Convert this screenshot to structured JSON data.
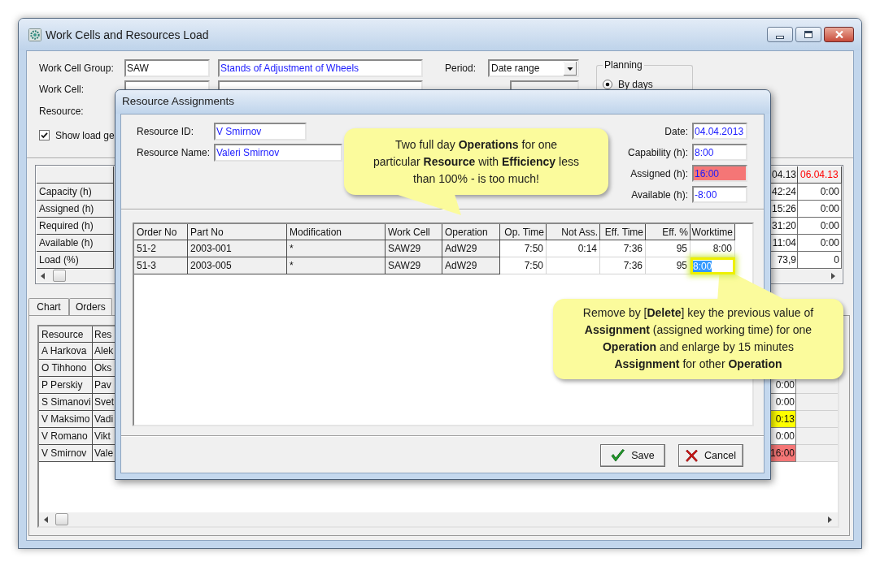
{
  "main_window": {
    "title": "Work Cells and Resources Load",
    "filters": {
      "work_cell_group": {
        "label": "Work Cell Group:",
        "code": "SAW",
        "description": "Stands of Adjustment of Wheels"
      },
      "work_cell": {
        "label": "Work Cell:"
      },
      "resource": {
        "label": "Resource:"
      },
      "show_load": {
        "label": "Show load ge",
        "checked": true
      },
      "period": {
        "label": "Period:",
        "value": "Date range"
      },
      "planning": {
        "title": "Planning",
        "options": [
          {
            "label": "By days",
            "selected": true
          }
        ]
      }
    },
    "load_grid": {
      "row_labels": [
        "Capacity (h)",
        "Assigned (h)",
        "Required (h)",
        "Available (h)",
        "Load (%)"
      ],
      "columns": [
        {
          "header": "04.13",
          "highlighted": false,
          "values": [
            "42:24",
            "15:26",
            "31:20",
            "11:04",
            "73,9"
          ]
        },
        {
          "header": "06.04.13",
          "highlighted": true,
          "values": [
            "0:00",
            "0:00",
            "0:00",
            "0:00",
            "0"
          ]
        }
      ]
    },
    "tabs": [
      {
        "label": "Chart",
        "selected": false
      },
      {
        "label": "Orders",
        "selected": false
      }
    ],
    "resource_grid": {
      "columns": [
        "Resource",
        "Res"
      ],
      "rows": [
        {
          "resource": "A Harkova",
          "name": "Alek"
        },
        {
          "resource": "O Tihhono",
          "name": "Oks"
        },
        {
          "resource": "P Perskiy",
          "name": "Pav",
          "load": "0:00",
          "color": "#ffffff"
        },
        {
          "resource": "S Simanovi",
          "name": "Svet",
          "load": "0:00",
          "color": "#ffffff"
        },
        {
          "resource": "V Maksimo",
          "name": "Vadi",
          "load": "0:13",
          "color": "#ffff00"
        },
        {
          "resource": "V Romano",
          "name": "Vikt",
          "load": "0:00",
          "color": "#ffffff"
        },
        {
          "resource": "V Smirnov",
          "name": "Vale",
          "load": "16:00",
          "color": "#f57676"
        }
      ]
    }
  },
  "dialog": {
    "title": "Resource Assignments",
    "resource_id": {
      "label": "Resource ID:",
      "value": "V Smirnov"
    },
    "resource_name": {
      "label": "Resource Name:",
      "value": "Valeri Smirnov"
    },
    "summary": [
      {
        "label": "Date:",
        "value": "04.04.2013",
        "overloaded": false
      },
      {
        "label": "Capability (h):",
        "value": "8:00",
        "overloaded": false
      },
      {
        "label": "Assigned (h):",
        "value": "16:00",
        "overloaded": true
      },
      {
        "label": "Available (h):",
        "value": "-8:00",
        "overloaded": false
      }
    ],
    "table": {
      "columns": [
        {
          "label": "Order No",
          "kind": "text"
        },
        {
          "label": "Part No",
          "kind": "text"
        },
        {
          "label": "Modification",
          "kind": "text"
        },
        {
          "label": "Work Cell",
          "kind": "text"
        },
        {
          "label": "Operation",
          "kind": "text"
        },
        {
          "label": "Op. Time",
          "kind": "number"
        },
        {
          "label": "Not Ass.",
          "kind": "number"
        },
        {
          "label": "Eff. Time",
          "kind": "number"
        },
        {
          "label": "Eff. %",
          "kind": "number"
        },
        {
          "label": "Worktime",
          "kind": "number"
        }
      ],
      "rows": [
        {
          "order_no": "51-2",
          "part_no": "2003-001",
          "modification": "*",
          "work_cell": "SAW29",
          "operation": "AdW29",
          "op_time": "7:50",
          "not_assigned": "0:14",
          "eff_time": "7:36",
          "eff_pct": "95",
          "worktime": "8:00",
          "editing": false
        },
        {
          "order_no": "51-3",
          "part_no": "2003-005",
          "modification": "*",
          "work_cell": "SAW29",
          "operation": "AdW29",
          "op_time": "7:50",
          "eff_time": "7:36",
          "eff_pct": "95",
          "worktime": "8:00",
          "editing": true
        }
      ]
    },
    "buttons": [
      {
        "label": "Save",
        "kind": "save"
      },
      {
        "label": "Cancel",
        "kind": "cancel"
      }
    ]
  },
  "callouts": [
    {
      "text": "Two full day **Operations** for one particular **Resource** with **Efficiency** less than 100% - is too much!"
    },
    {
      "text": "Remove by [**Delete**] key the previous value of **Assignment** (assigned working time) for one **Operation** and enlarge by 15 minutes **Assignment** for other **Operation**"
    }
  ]
}
